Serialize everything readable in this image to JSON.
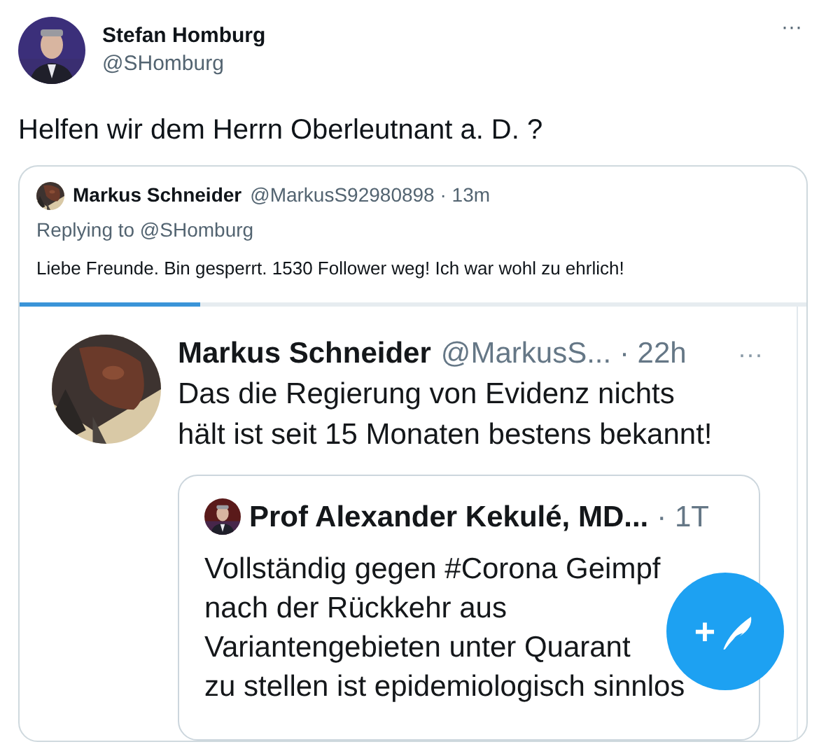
{
  "tweet": {
    "name": "Stefan Homburg",
    "handle": "@SHomburg",
    "more": "···",
    "text": "Helfen wir dem Herrn Oberleutnant a. D. ?"
  },
  "quote": {
    "name": "Markus Schneider",
    "handle": "@MarkusS92980898",
    "time": "· 13m",
    "replying": "Replying to @SHomburg",
    "text": "Liebe Freunde. Bin gesperrt. 1530 Follower weg! Ich war wohl zu ehrlich!"
  },
  "media_progress": {
    "level": 0.23
  },
  "screenshot": {
    "name": "Markus Schneider",
    "handle": "@MarkusS...",
    "time": "· 22h",
    "more": "···",
    "lines": [
      "Das die Regierung von Evidenz nichts",
      "hält ist seit 15 Monaten bestens bekannt!"
    ],
    "inner_quote": {
      "name": "Prof Alexander Kekulé, MD...",
      "time": "· 1T",
      "lines": [
        "Vollständig gegen #Corona Geimpf",
        "nach der Rückkehr aus",
        "Variantengebieten unter Quarant",
        "zu stellen ist epidemiologisch sinnlos"
      ]
    },
    "fab": {
      "plus": "+"
    }
  }
}
